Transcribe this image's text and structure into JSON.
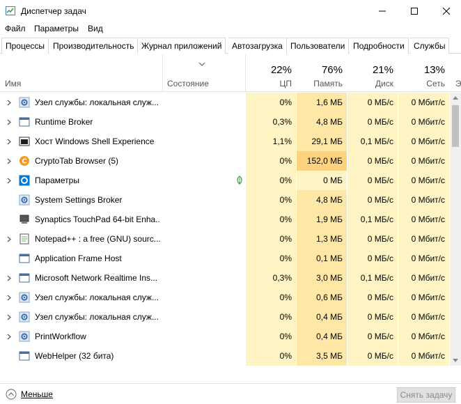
{
  "window": {
    "title": "Диспетчер задач"
  },
  "menu": [
    "Файл",
    "Параметры",
    "Вид"
  ],
  "tabs": [
    "Процессы",
    "Производительность",
    "Журнал приложений",
    "Автозагрузка",
    "Пользователи",
    "Подробности",
    "Службы"
  ],
  "active_tab": "Процессы",
  "columns": {
    "name": "Имя",
    "status": "Состояние",
    "cpu": {
      "pct": "22%",
      "label": "ЦП"
    },
    "mem": {
      "pct": "76%",
      "label": "Память"
    },
    "disk": {
      "pct": "21%",
      "label": "Диск"
    },
    "net": {
      "pct": "13%",
      "label": "Сеть"
    },
    "more": "Э"
  },
  "colors": {
    "heat_low": "#fff4c4",
    "heat_mid": "#ffe8a6",
    "heat_high": "#ffd27f",
    "accent": "#0078d7"
  },
  "rows": [
    {
      "name": "Узел службы: локальная служ...",
      "icon": "gear-icon",
      "expand": true,
      "leaf": false,
      "cpu": "0%",
      "mem": "1,6 МБ",
      "disk": "0 МБ/с",
      "net": "0 Мбит/с",
      "memHeat": "mid"
    },
    {
      "name": "Runtime Broker",
      "icon": "window-icon",
      "expand": true,
      "leaf": false,
      "cpu": "0,3%",
      "mem": "4,8 МБ",
      "disk": "0 МБ/с",
      "net": "0 Мбит/с",
      "memHeat": "mid"
    },
    {
      "name": "Хост Windows Shell Experience",
      "icon": "shell-icon",
      "expand": true,
      "leaf": false,
      "cpu": "1,1%",
      "mem": "29,1 МБ",
      "disk": "0,1 МБ/с",
      "net": "0 Мбит/с",
      "memHeat": "mid"
    },
    {
      "name": "CryptoTab Browser (5)",
      "icon": "cryptotab-icon",
      "expand": true,
      "leaf": false,
      "cpu": "0%",
      "mem": "152,0 МБ",
      "disk": "0 МБ/с",
      "net": "0 Мбит/с",
      "memHeat": "high"
    },
    {
      "name": "Параметры",
      "icon": "settings-icon",
      "expand": true,
      "leaf": true,
      "cpu": "0%",
      "mem": "0 МБ",
      "disk": "0 МБ/с",
      "net": "0 Мбит/с",
      "memHeat": "low"
    },
    {
      "name": "System Settings Broker",
      "icon": "gear-icon",
      "expand": false,
      "leaf": false,
      "cpu": "0%",
      "mem": "4,8 МБ",
      "disk": "0 МБ/с",
      "net": "0 Мбит/с",
      "memHeat": "mid"
    },
    {
      "name": "Synaptics TouchPad 64-bit Enha...",
      "icon": "touchpad-icon",
      "expand": false,
      "leaf": false,
      "cpu": "0%",
      "mem": "1,9 МБ",
      "disk": "0,1 МБ/с",
      "net": "0 Мбит/с",
      "memHeat": "mid"
    },
    {
      "name": "Notepad++ : a free (GNU) sourc...",
      "icon": "notepad-icon",
      "expand": true,
      "leaf": false,
      "cpu": "0%",
      "mem": "1,3 МБ",
      "disk": "0 МБ/с",
      "net": "0 Мбит/с",
      "memHeat": "mid"
    },
    {
      "name": "Application Frame Host",
      "icon": "window-icon",
      "expand": false,
      "leaf": false,
      "cpu": "0%",
      "mem": "0,1 МБ",
      "disk": "0 МБ/с",
      "net": "0 Мбит/с",
      "memHeat": "mid"
    },
    {
      "name": "Microsoft Network Realtime Ins...",
      "icon": "window-icon",
      "expand": true,
      "leaf": false,
      "cpu": "0,3%",
      "mem": "3,0 МБ",
      "disk": "0,1 МБ/с",
      "net": "0 Мбит/с",
      "memHeat": "mid"
    },
    {
      "name": "Узел службы: локальная служ...",
      "icon": "gear-icon",
      "expand": true,
      "leaf": false,
      "cpu": "0%",
      "mem": "0,6 МБ",
      "disk": "0 МБ/с",
      "net": "0 Мбит/с",
      "memHeat": "mid"
    },
    {
      "name": "Узел службы: локальная служ...",
      "icon": "gear-icon",
      "expand": true,
      "leaf": false,
      "cpu": "0%",
      "mem": "0,4 МБ",
      "disk": "0 МБ/с",
      "net": "0 Мбит/с",
      "memHeat": "mid"
    },
    {
      "name": "PrintWorkflow",
      "icon": "gear-icon",
      "expand": true,
      "leaf": false,
      "cpu": "0%",
      "mem": "0,4 МБ",
      "disk": "0 МБ/с",
      "net": "0 Мбит/с",
      "memHeat": "mid"
    },
    {
      "name": "WebHelper (32 бита)",
      "icon": "window-icon",
      "expand": false,
      "leaf": false,
      "cpu": "0%",
      "mem": "3,5 МБ",
      "disk": "0 МБ/с",
      "net": "0 Мбит/с",
      "memHeat": "mid"
    }
  ],
  "footer": {
    "less": "Меньше",
    "end_task": "Снять задачу"
  }
}
